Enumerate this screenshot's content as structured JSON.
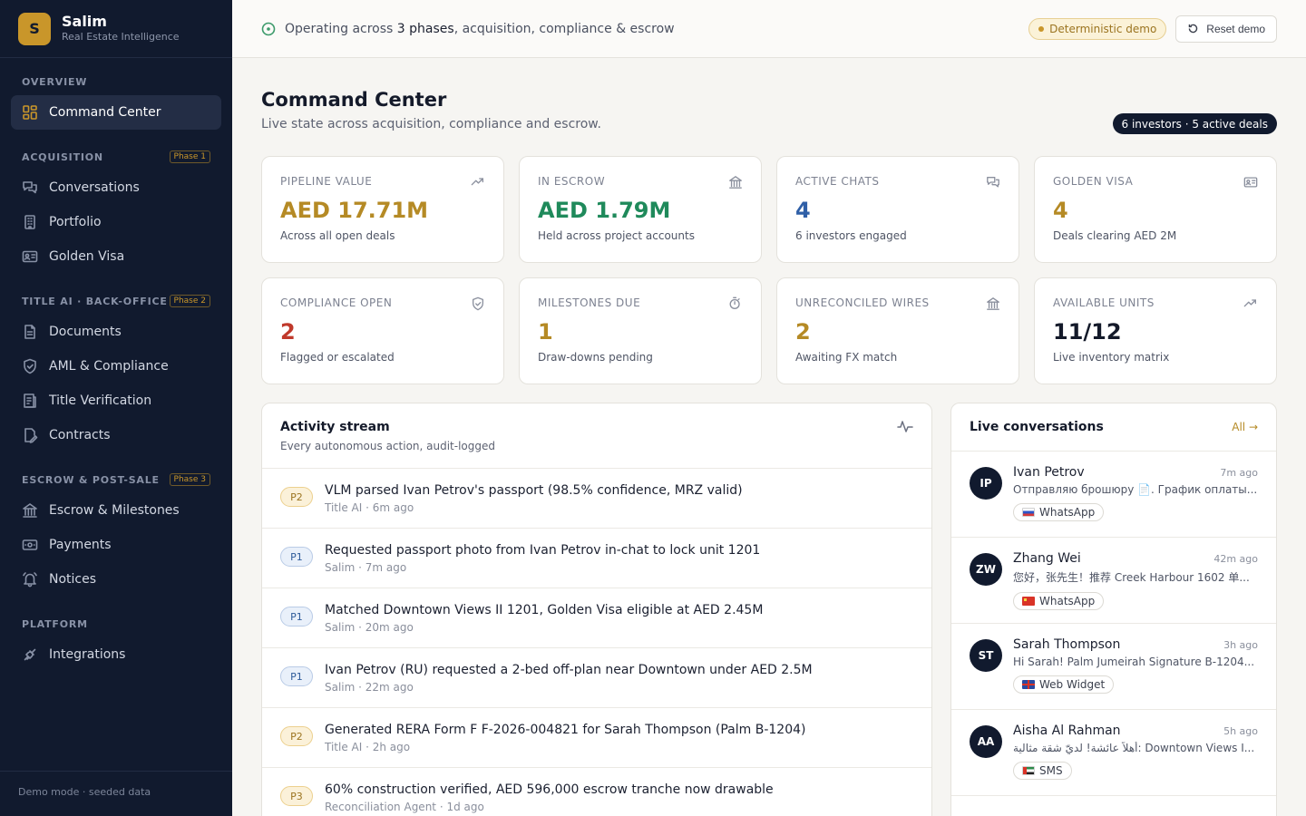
{
  "brand": {
    "initial": "S",
    "name": "Salim",
    "subtitle": "Real Estate Intelligence"
  },
  "sidebar": {
    "sections": [
      {
        "heading": "OVERVIEW",
        "phase": "",
        "items": [
          {
            "label": "Command Center",
            "icon": "grid-icon",
            "active": true
          }
        ]
      },
      {
        "heading": "ACQUISITION",
        "phase": "Phase 1",
        "items": [
          {
            "label": "Conversations",
            "icon": "chat-icon"
          },
          {
            "label": "Portfolio",
            "icon": "building-icon"
          },
          {
            "label": "Golden Visa",
            "icon": "id-card-icon"
          }
        ]
      },
      {
        "heading": "TITLE AI · BACK-OFFICE",
        "phase": "Phase 2",
        "items": [
          {
            "label": "Documents",
            "icon": "document-icon"
          },
          {
            "label": "AML & Compliance",
            "icon": "shield-icon"
          },
          {
            "label": "Title Verification",
            "icon": "ledger-icon"
          },
          {
            "label": "Contracts",
            "icon": "contract-icon"
          }
        ]
      },
      {
        "heading": "ESCROW & POST-SALE",
        "phase": "Phase 3",
        "items": [
          {
            "label": "Escrow & Milestones",
            "icon": "bank-icon"
          },
          {
            "label": "Payments",
            "icon": "payment-icon"
          },
          {
            "label": "Notices",
            "icon": "bell-icon"
          }
        ]
      },
      {
        "heading": "PLATFORM",
        "phase": "",
        "items": [
          {
            "label": "Integrations",
            "icon": "plug-icon"
          }
        ]
      }
    ],
    "footer": "Demo mode · seeded data"
  },
  "topbar": {
    "status_prefix": "Operating across ",
    "status_bold": "3 phases",
    "status_suffix": ", acquisition, compliance & escrow",
    "demo_badge": "Deterministic demo",
    "reset_label": "Reset demo"
  },
  "page": {
    "title": "Command Center",
    "subtitle": "Live state across acquisition, compliance and escrow.",
    "counts": "6 investors · 5 active deals"
  },
  "stats": [
    {
      "label": "PIPELINE VALUE",
      "value": "AED 17.71M",
      "desc": "Across all open deals",
      "color": "#b58a25",
      "icon": "trend-up-icon"
    },
    {
      "label": "IN ESCROW",
      "value": "AED 1.79M",
      "desc": "Held across project accounts",
      "color": "#1f8a5b",
      "icon": "bank-icon"
    },
    {
      "label": "ACTIVE CHATS",
      "value": "4",
      "desc": "6 investors engaged",
      "color": "#2f5fa7",
      "icon": "chat-icon"
    },
    {
      "label": "GOLDEN VISA",
      "value": "4",
      "desc": "Deals clearing AED 2M",
      "color": "#b58a25",
      "icon": "id-card-icon"
    },
    {
      "label": "COMPLIANCE OPEN",
      "value": "2",
      "desc": "Flagged or escalated",
      "color": "#c0392b",
      "icon": "shield-icon"
    },
    {
      "label": "MILESTONES DUE",
      "value": "1",
      "desc": "Draw-downs pending",
      "color": "#b58a25",
      "icon": "timer-icon"
    },
    {
      "label": "UNRECONCILED WIRES",
      "value": "2",
      "desc": "Awaiting FX match",
      "color": "#b58a25",
      "icon": "bank-icon"
    },
    {
      "label": "AVAILABLE UNITS",
      "value": "11/12",
      "desc": "Live inventory matrix",
      "color": "#141a2a",
      "icon": "trend-up-icon"
    }
  ],
  "activity": {
    "title": "Activity stream",
    "subtitle": "Every autonomous action, audit-logged",
    "items": [
      {
        "priority": "P2",
        "text": "VLM parsed Ivan Petrov's passport (98.5% confidence, MRZ valid)",
        "meta": "Title AI · 6m ago"
      },
      {
        "priority": "P1",
        "text": "Requested passport photo from Ivan Petrov in-chat to lock unit 1201",
        "meta": "Salim · 7m ago"
      },
      {
        "priority": "P1",
        "text": "Matched Downtown Views II 1201, Golden Visa eligible at AED 2.45M",
        "meta": "Salim · 20m ago"
      },
      {
        "priority": "P1",
        "text": "Ivan Petrov (RU) requested a 2-bed off-plan near Downtown under AED 2.5M",
        "meta": "Salim · 22m ago"
      },
      {
        "priority": "P2",
        "text": "Generated RERA Form F F-2026-004821 for Sarah Thompson (Palm B-1204)",
        "meta": "Title AI · 2h ago"
      },
      {
        "priority": "P3",
        "text": "60% construction verified, AED 596,000 escrow tranche now drawable",
        "meta": "Reconciliation Agent · 1d ago"
      }
    ]
  },
  "conversations": {
    "title": "Live conversations",
    "all_label": "All →",
    "items": [
      {
        "initials": "IP",
        "name": "Ivan Petrov",
        "time": "7m ago",
        "message": "Отправляю брошюру 📄. График оплаты...",
        "channel": "WhatsApp",
        "flag": "ru"
      },
      {
        "initials": "ZW",
        "name": "Zhang Wei",
        "time": "42m ago",
        "message": "您好，张先生！推荐 Creek Harbour 1602 单...",
        "channel": "WhatsApp",
        "flag": "cn"
      },
      {
        "initials": "ST",
        "name": "Sarah Thompson",
        "time": "3h ago",
        "message": "Hi Sarah! Palm Jumeirah Signature B-1204...",
        "channel": "Web Widget",
        "flag": "gb"
      },
      {
        "initials": "AA",
        "name": "Aisha Al Rahman",
        "time": "5h ago",
        "message": "أهلاً عائشة! لديّ شقة مثالية: Downtown Views I...",
        "channel": "SMS",
        "flag": "ae"
      }
    ]
  }
}
